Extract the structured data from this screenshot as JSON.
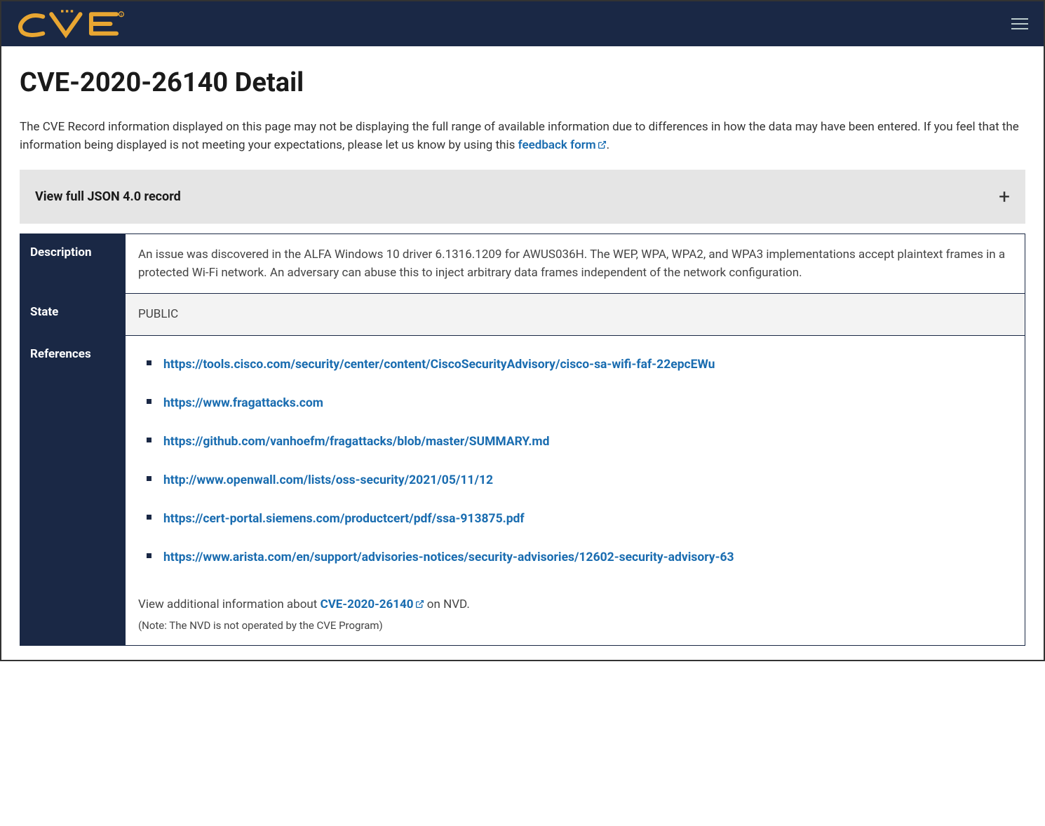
{
  "header": {
    "logo_text": "CVE"
  },
  "title": "CVE-2020-26140 Detail",
  "intro_prefix": "The CVE Record information displayed on this page may not be displaying the full range of available information due to differences in how the data may have been entered. If you feel that the information being displayed is not meeting your expectations, please let us know by using this ",
  "intro_link": "feedback form",
  "json_toggle_label": "View full JSON 4.0 record",
  "table": {
    "description_label": "Description",
    "description_value": "An issue was discovered in the ALFA Windows 10 driver 6.1316.1209 for AWUS036H. The WEP, WPA, WPA2, and WPA3 implementations accept plaintext frames in a protected Wi-Fi network. An adversary can abuse this to inject arbitrary data frames independent of the network configuration.",
    "state_label": "State",
    "state_value": "PUBLIC",
    "references_label": "References",
    "references": [
      "https://tools.cisco.com/security/center/content/CiscoSecurityAdvisory/cisco-sa-wifi-faf-22epcEWu",
      "https://www.fragattacks.com",
      "https://github.com/vanhoefm/fragattacks/blob/master/SUMMARY.md",
      "http://www.openwall.com/lists/oss-security/2021/05/11/12",
      "https://cert-portal.siemens.com/productcert/pdf/ssa-913875.pdf",
      "https://www.arista.com/en/support/advisories-notices/security-advisories/12602-security-advisory-63"
    ],
    "nvd_prefix": "View additional information about ",
    "nvd_link": "CVE-2020-26140",
    "nvd_suffix": " on NVD.",
    "nvd_note": "(Note: The NVD is not operated by the CVE Program)"
  }
}
